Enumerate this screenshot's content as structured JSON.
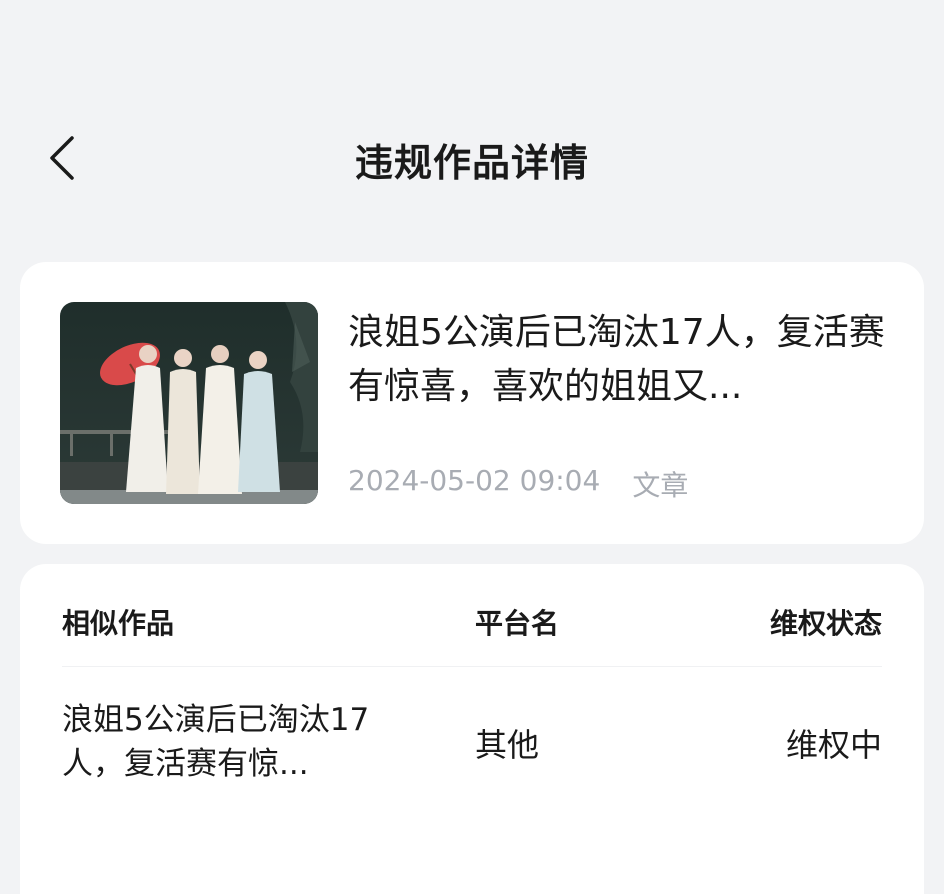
{
  "header": {
    "title": "违规作品详情",
    "back_icon": "chevron-left-icon"
  },
  "work": {
    "title": "浪姐5公演后已淘汰17人，复活赛有惊喜，喜欢的姐姐又...",
    "datetime": "2024-05-02 09:04",
    "type": "文章",
    "thumbnail": "stage-performers-with-red-umbrella-image"
  },
  "similar": {
    "columns": [
      "相似作品",
      "平台名",
      "维权状态"
    ],
    "rows": [
      {
        "title": "浪姐5公演后已淘汰17人，复活赛有惊...",
        "platform": "其他",
        "status": "维权中"
      }
    ]
  },
  "colors": {
    "background": "#f2f3f5",
    "card": "#ffffff",
    "text": "#1a1a1a",
    "meta_text": "#a8acb3"
  }
}
